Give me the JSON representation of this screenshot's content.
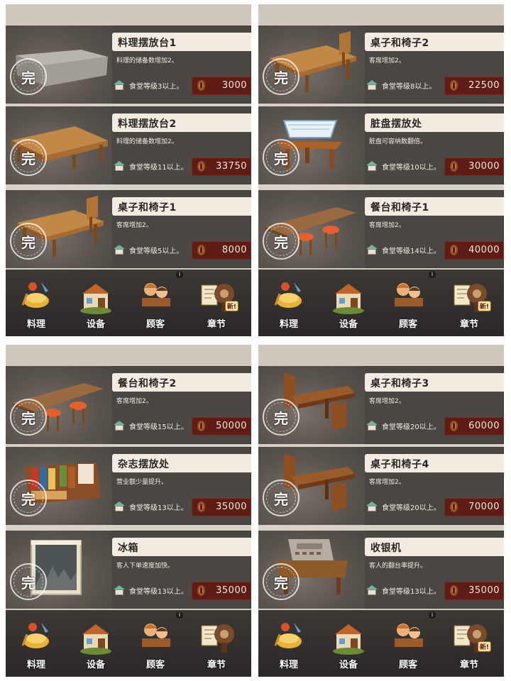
{
  "screens": [
    {
      "items": [
        {
          "name": "料理摆放台1",
          "desc": "料理的储备数增加2。",
          "req": "食堂等级3以上。",
          "price": "3000",
          "done": "完",
          "art": "stone-counter"
        },
        {
          "name": "料理摆放台2",
          "desc": "料理的储备数增加2。",
          "req": "食堂等级11以上。",
          "price": "33750",
          "done": "完",
          "art": "wood-counter"
        },
        {
          "name": "桌子和椅子1",
          "desc": "客席增加2。",
          "req": "食堂等级5以上。",
          "price": "8000",
          "done": "完",
          "art": "table-chair"
        }
      ],
      "nav": [
        {
          "label": "料理",
          "icon": "dish-icon"
        },
        {
          "label": "设备",
          "icon": "shop-icon"
        },
        {
          "label": "顾客",
          "icon": "customers-icon"
        },
        {
          "label": "章节",
          "icon": "chapter-icon",
          "badge": "新!"
        }
      ]
    },
    {
      "items": [
        {
          "name": "桌子和椅子2",
          "desc": "客席增加2。",
          "req": "食堂等级8以上。",
          "price": "22500",
          "done": "完",
          "art": "table-chair"
        },
        {
          "name": "脏盘摆放处",
          "desc": "脏盘可容纳数翻倍。",
          "req": "食堂等级10以上。",
          "price": "30000",
          "done": "完",
          "art": "dish-rack"
        },
        {
          "name": "餐台和椅子1",
          "desc": "客席增加2。",
          "req": "食堂等级14以上。",
          "price": "40000",
          "done": "完",
          "art": "bar-stools"
        }
      ],
      "nav": [
        {
          "label": "料理",
          "icon": "dish-icon"
        },
        {
          "label": "设备",
          "icon": "shop-icon"
        },
        {
          "label": "顾客",
          "icon": "customers-icon"
        },
        {
          "label": "章节",
          "icon": "chapter-icon",
          "badge": "新!"
        }
      ]
    },
    {
      "items": [
        {
          "name": "餐台和椅子2",
          "desc": "客席增加2。",
          "req": "食堂等级15以上。",
          "price": "50000",
          "done": "完",
          "art": "bar-stools"
        },
        {
          "name": "杂志摆放处",
          "desc": "营业额少量提升。",
          "req": "食堂等级13以上。",
          "price": "35000",
          "done": "完",
          "art": "magazine-rack"
        },
        {
          "name": "冰箱",
          "desc": "客人下单速度加快。",
          "req": "食堂等级13以上。",
          "price": "35000",
          "done": "完",
          "art": "fridge"
        }
      ],
      "nav": [
        {
          "label": "料理",
          "icon": "dish-icon"
        },
        {
          "label": "设备",
          "icon": "shop-icon"
        },
        {
          "label": "顾客",
          "icon": "customers-icon"
        },
        {
          "label": "章节",
          "icon": "chapter-icon"
        }
      ]
    },
    {
      "items": [
        {
          "name": "桌子和椅子3",
          "desc": "客席增加2。",
          "req": "食堂等级20以上。",
          "price": "60000",
          "done": "完",
          "art": "booth-table"
        },
        {
          "name": "桌子和椅子4",
          "desc": "客席增加2。",
          "req": "食堂等级20以上。",
          "price": "70000",
          "done": "完",
          "art": "booth-table"
        },
        {
          "name": "收银机",
          "desc": "客人的翻台率提升。",
          "req": "食堂等级13以上。",
          "price": "35000",
          "done": "完",
          "art": "cash-register"
        }
      ],
      "nav": [
        {
          "label": "料理",
          "icon": "dish-icon"
        },
        {
          "label": "设备",
          "icon": "shop-icon"
        },
        {
          "label": "顾客",
          "icon": "customers-icon"
        },
        {
          "label": "章节",
          "icon": "chapter-icon",
          "badge": "新!"
        }
      ]
    }
  ],
  "colors": {
    "row_bg": "#4a4642",
    "price_bg": "#5d1c14",
    "banner_bg": "#f1ebe1"
  }
}
